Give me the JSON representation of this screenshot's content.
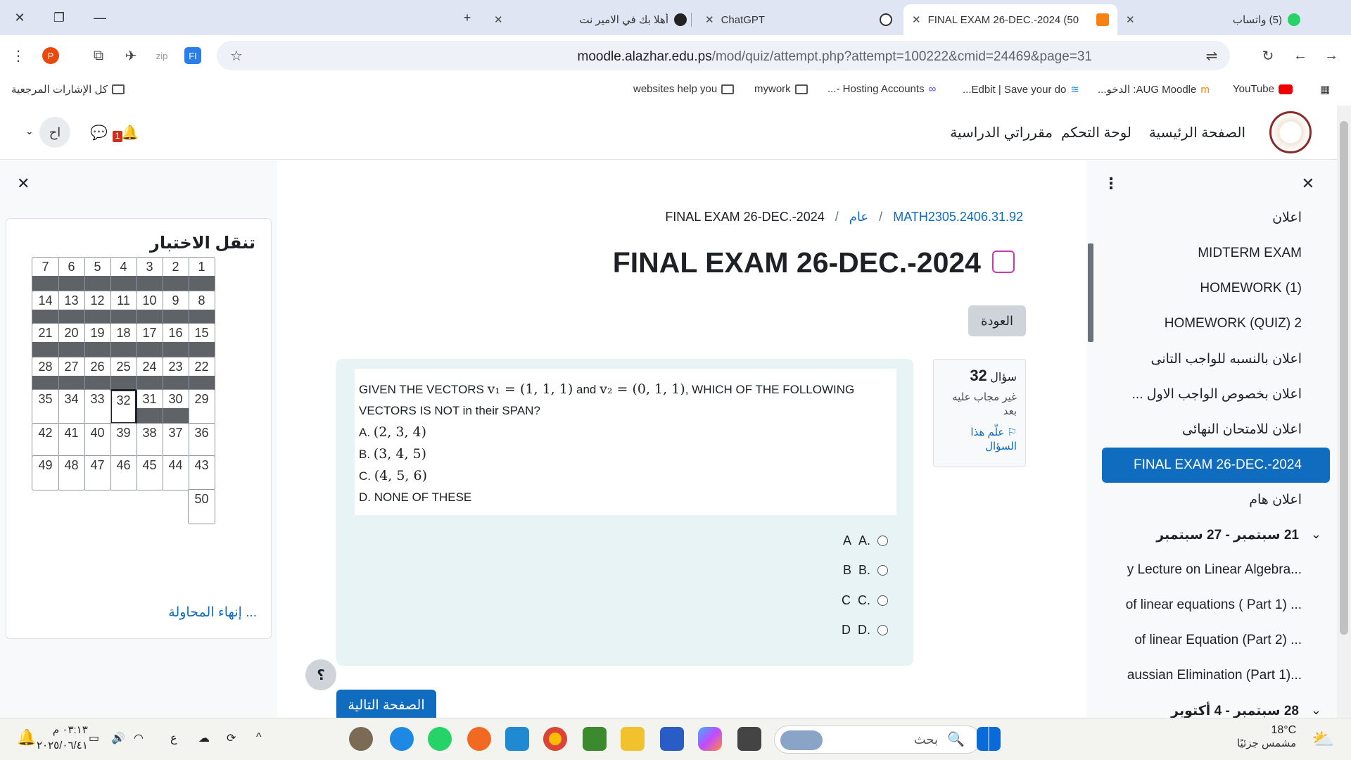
{
  "browser": {
    "tabs": [
      {
        "title": "(5) واتساب",
        "active": false
      },
      {
        "title": "FINAL EXAM 26-DEC.-2024 (50",
        "active": true
      },
      {
        "title": "ChatGPT",
        "active": false
      },
      {
        "title": "أهلا بك في الامير نت",
        "active": false
      }
    ],
    "url_host": "moodle.alazhar.edu.ps",
    "url_path": "/mod/quiz/attempt.php?attempt=100222&cmid=24469&page=31",
    "bookmarks": [
      {
        "label": "YouTube"
      },
      {
        "label": "AUG Moodle: الدخو..."
      },
      {
        "label": "Edbit | Save your do..."
      },
      {
        "label": "Hosting Accounts -..."
      },
      {
        "label": "mywork"
      },
      {
        "label": "websites help you"
      }
    ],
    "all_bookmarks": "كل الإشارات المرجعية"
  },
  "header": {
    "nav": [
      "الصفحة الرئيسية",
      "لوحة التحكم",
      "مقرراتي الدراسية"
    ],
    "avatar_initials": "اح",
    "notification_count": "1"
  },
  "quiz_nav": {
    "title": "تنقل الاختبار",
    "current": 32,
    "finish": "إنهاء المحاولة ..."
  },
  "breadcrumb": {
    "course": "MATH2305.2406.31.92",
    "section": "عام",
    "page": "FINAL EXAM 26-DEC.-2024"
  },
  "page_title": "FINAL EXAM 26-DEC.-2024",
  "back_button": "العودة",
  "question_info": {
    "label": "سؤال",
    "number": "32",
    "state": "غير مجاب عليه بعد",
    "flag": "علّم هذا السؤال"
  },
  "question": {
    "intro": "GIVEN THE VECTORS",
    "v1": "v₁ = (1, 1, 1)",
    "and": "and",
    "v2": "v₂ = (0, 1, 1)",
    "tail": ", WHICH OF THE FOLLOWING VECTORS IS NOT in their SPAN?",
    "choices": [
      {
        "label": "A.",
        "value": "(2, 3, 4)"
      },
      {
        "label": "B.",
        "value": "(3, 4, 5)"
      },
      {
        "label": "C.",
        "value": "(4, 5, 6)"
      },
      {
        "label": "D.",
        "value": "NONE OF THESE"
      }
    ],
    "answers": [
      {
        "letter": ".A",
        "text": "A"
      },
      {
        "letter": ".B",
        "text": "B"
      },
      {
        "letter": ".C",
        "text": "C"
      },
      {
        "letter": ".D",
        "text": "D"
      }
    ]
  },
  "help_label": "؟",
  "next_button": "الصفحة التالية",
  "course_index": {
    "items": [
      "اعلان",
      "MIDTERM EXAM",
      "HOMEWORK (1)",
      "HOMEWORK (QUIZ) 2",
      "اعلان بالنسبه للواجب التانى",
      "اعلان بخصوص الواجب الاول ...",
      "اعلان للامتحان النهائى",
      "FINAL EXAM 26-DEC.-2024",
      "اعلان هام",
      "21 سبتمبر - 27 سبتمبر",
      "...y Lecture on Linear Algebra",
      "... of linear equations ( Part 1)",
      "... of linear Equation (Part 2)",
      "...aussian Elimination (Part 1)",
      "28 سبتمبر - 4 أكتوبر"
    ]
  },
  "taskbar": {
    "weather_temp": "18°C",
    "weather_text": "مشمس جزئيًا",
    "search_label": "بحث",
    "time": "٠٣:١٣ م",
    "date": "٢٠٢٥/٠٦/٤١",
    "lang": "ع"
  },
  "colors": {
    "primary": "#0f6cbf",
    "tabstrip": "#dfe5f2",
    "question_bg": "#e7f3f5",
    "answered_state": "#5f6368"
  }
}
